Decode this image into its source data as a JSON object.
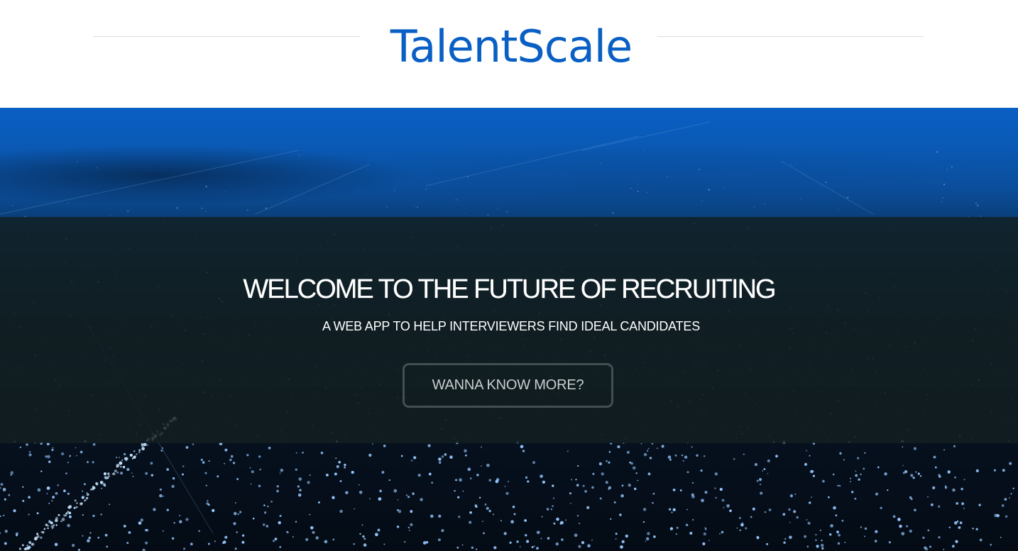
{
  "header": {
    "logo_text": "TalentScale"
  },
  "hero": {
    "headline": "WELCOME TO THE FUTURE OF RECRUITING",
    "subheadline": "A WEB APP TO HELP INTERVIEWERS FIND IDEAL CANDIDATES",
    "cta_label": "WANNA KNOW MORE?"
  },
  "colors": {
    "brand_blue": "#0a5fc4",
    "overlay": "#121e20",
    "text_white": "#ffffff",
    "cta_text": "#c9cecf"
  }
}
